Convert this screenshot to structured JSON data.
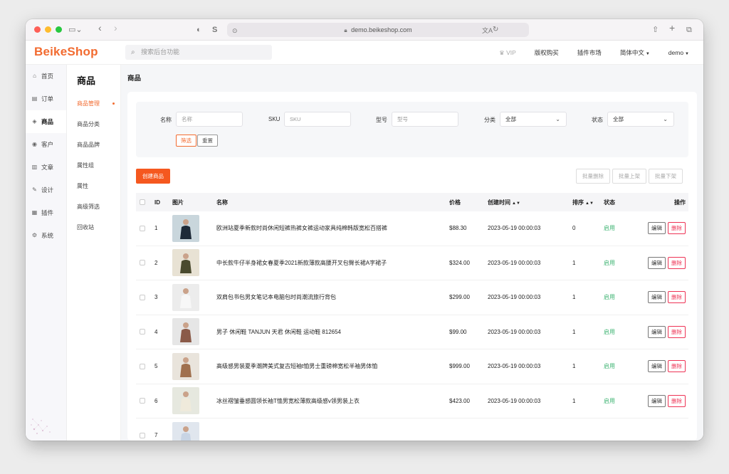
{
  "browser": {
    "url": "demo.beikeshop.com",
    "back": "‹",
    "forward": "›"
  },
  "header": {
    "logo": "BeikeShop",
    "search_placeholder": "搜索后台功能",
    "vip": "VIP",
    "nav": [
      "版权购买",
      "插件市场",
      "简体中文",
      "demo"
    ]
  },
  "leftnav": [
    {
      "label": "首页",
      "icon": "home-icon",
      "glyph": "⌂"
    },
    {
      "label": "订单",
      "icon": "order-icon",
      "glyph": "▤"
    },
    {
      "label": "商品",
      "icon": "product-icon",
      "glyph": "◈"
    },
    {
      "label": "客户",
      "icon": "customer-icon",
      "glyph": "◉"
    },
    {
      "label": "文章",
      "icon": "article-icon",
      "glyph": "▥"
    },
    {
      "label": "设计",
      "icon": "design-icon",
      "glyph": "✎"
    },
    {
      "label": "插件",
      "icon": "plugin-icon",
      "glyph": "▦"
    },
    {
      "label": "系统",
      "icon": "system-icon",
      "glyph": "⚙"
    }
  ],
  "subnav": {
    "title": "商品",
    "items": [
      "商品管理",
      "商品分类",
      "商品品牌",
      "属性组",
      "属性",
      "高级筛选",
      "回收站"
    ]
  },
  "page_title": "商品",
  "filter": {
    "name_label": "名称",
    "name_placeholder": "名称",
    "sku_label": "SKU",
    "sku_placeholder": "SKU",
    "model_label": "型号",
    "model_placeholder": "型号",
    "category_label": "分类",
    "category_value": "全部",
    "status_label": "状态",
    "status_value": "全部",
    "filter_button": "筛选",
    "reset_button": "重置"
  },
  "actions": {
    "create": "创建商品",
    "batch_delete": "批量删除",
    "batch_on": "批量上架",
    "batch_off": "批量下架"
  },
  "table": {
    "headers": {
      "id": "ID",
      "image": "图片",
      "name": "名称",
      "price": "价格",
      "created": "创建时间",
      "sort": "排序",
      "status": "状态",
      "ops": "操作"
    },
    "edit_label": "编辑",
    "delete_label": "删除",
    "rows": [
      {
        "id": "1",
        "name": "欧洲站夏季新款时尚休闲短裤热裤女裤运动家具纯棉韩版宽松百搭裤",
        "price": "$88.30",
        "created": "2023-05-19 00:00:03",
        "sort": "0",
        "status": "启用",
        "img_bg": "#c9d6dc",
        "img_fg": "#1e2a38"
      },
      {
        "id": "2",
        "name": "中长款牛仔半身裙女春夏季2021新款薄款高腰开叉包臀长裙A字裙子",
        "price": "$324.00",
        "created": "2023-05-19 00:00:03",
        "sort": "1",
        "status": "启用",
        "img_bg": "#e8e2d4",
        "img_fg": "#4a4a2e"
      },
      {
        "id": "3",
        "name": "双肩包书包男女笔记本电脑包时尚潮流旅行背包",
        "price": "$299.00",
        "created": "2023-05-19 00:00:03",
        "sort": "1",
        "status": "启用",
        "img_bg": "#ececec",
        "img_fg": "#f7f7f7"
      },
      {
        "id": "4",
        "name": "男子 休闲鞋 TANJUN 天君 休闲鞋 运动鞋 812654",
        "price": "$99.00",
        "created": "2023-05-19 00:00:03",
        "sort": "1",
        "status": "启用",
        "img_bg": "#e6e6e6",
        "img_fg": "#8a5a48"
      },
      {
        "id": "5",
        "name": "高级感男装夏季潮牌美式复古短袖t恤男士重磅棉宽松半袖男体恤",
        "price": "$999.00",
        "created": "2023-05-19 00:00:03",
        "sort": "1",
        "status": "启用",
        "img_bg": "#e9e4dc",
        "img_fg": "#a0704e"
      },
      {
        "id": "6",
        "name": "冰丝褶皱垂感圆领长袖T恤男宽松薄款高级感v领男装上衣",
        "price": "$423.00",
        "created": "2023-05-19 00:00:03",
        "sort": "1",
        "status": "启用",
        "img_bg": "#e6e8df",
        "img_fg": "#efeadb"
      },
      {
        "id": "7",
        "name": "",
        "price": "",
        "created": "",
        "sort": "",
        "status": "",
        "img_bg": "#e0e6ee",
        "img_fg": "#c8d4e4"
      }
    ]
  },
  "colors": {
    "brand": "#f26b30",
    "create_button": "#f5581f",
    "status_enabled": "#3cb371",
    "delete": "#e33355"
  }
}
